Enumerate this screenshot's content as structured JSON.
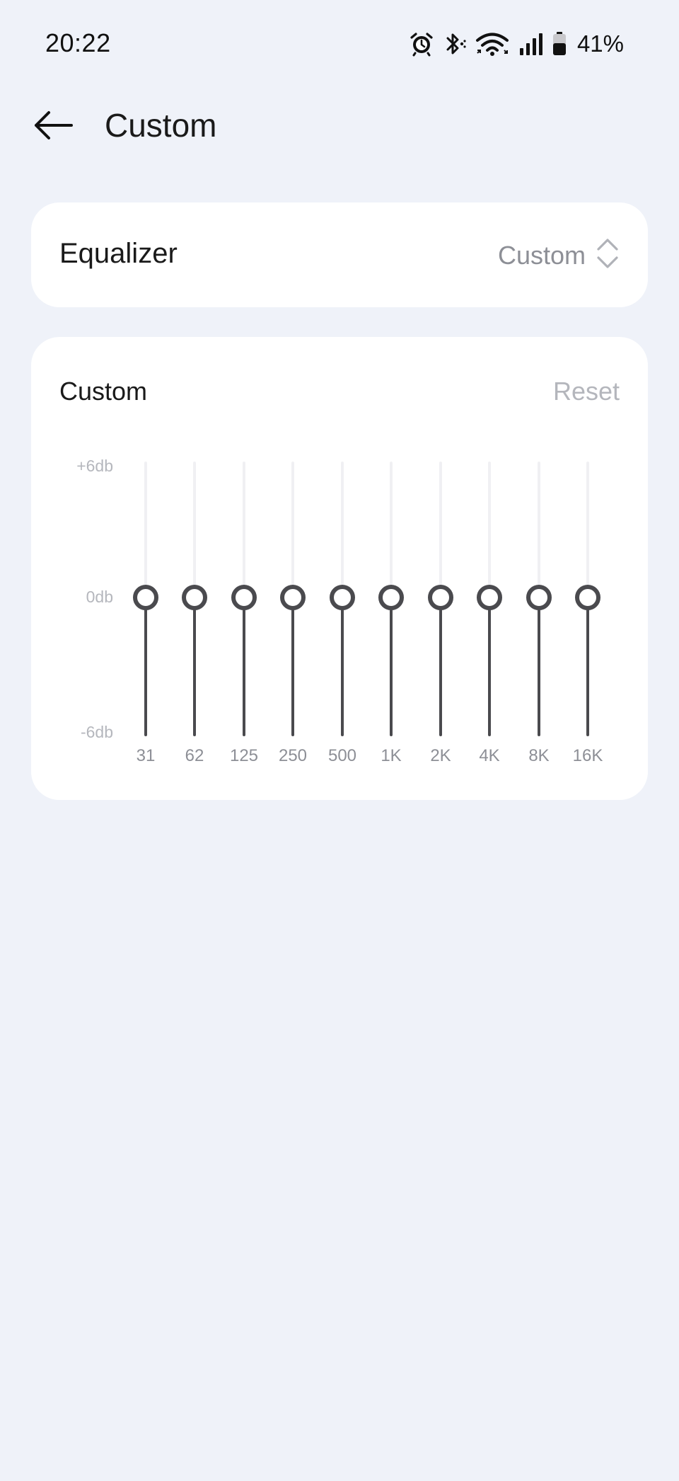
{
  "status_bar": {
    "time": "20:22",
    "battery_percent": "41%",
    "icons": [
      "alarm-icon",
      "bluetooth-icon",
      "wifi-icon",
      "signal-icon",
      "battery-icon"
    ]
  },
  "app_bar": {
    "title": "Custom",
    "back_icon": "arrow-left-icon"
  },
  "equalizer": {
    "label": "Equalizer",
    "selected_preset": "Custom",
    "selector_icon": "up-down-chevron-icon"
  },
  "bands_panel": {
    "title": "Custom",
    "reset_label": "Reset",
    "db_labels": {
      "top": "+6db",
      "middle": "0db",
      "bottom": "-6db"
    },
    "bands": [
      {
        "label": "31",
        "gain_db": 0
      },
      {
        "label": "62",
        "gain_db": 0
      },
      {
        "label": "125",
        "gain_db": 0
      },
      {
        "label": "250",
        "gain_db": 0
      },
      {
        "label": "500",
        "gain_db": 0
      },
      {
        "label": "1K",
        "gain_db": 0
      },
      {
        "label": "2K",
        "gain_db": 0
      },
      {
        "label": "4K",
        "gain_db": 0
      },
      {
        "label": "8K",
        "gain_db": 0
      },
      {
        "label": "16K",
        "gain_db": 0
      }
    ]
  },
  "colors": {
    "background": "#eff2f9",
    "card": "#ffffff",
    "slider_active": "#4a4a4e",
    "slider_inactive": "#f0f0f3",
    "muted_text": "#8d8f96"
  }
}
